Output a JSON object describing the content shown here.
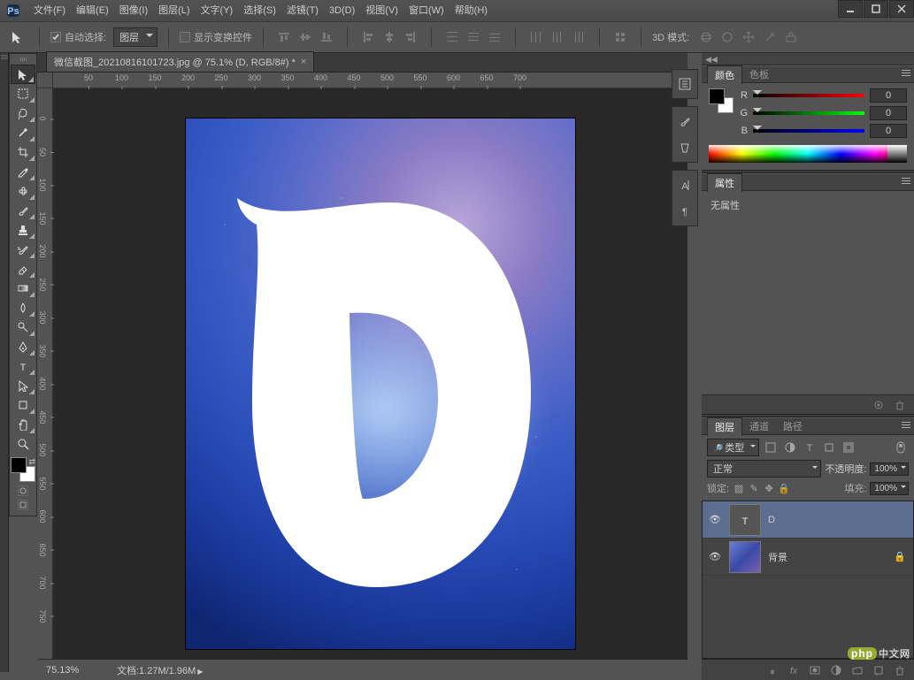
{
  "menubar": {
    "items": [
      "文件(F)",
      "编辑(E)",
      "图像(I)",
      "图层(L)",
      "文字(Y)",
      "选择(S)",
      "滤镜(T)",
      "3D(D)",
      "视图(V)",
      "窗口(W)",
      "帮助(H)"
    ]
  },
  "optionsbar": {
    "auto_select_label": "自动选择:",
    "select_mode": "图层",
    "show_transform_label": "显示变换控件",
    "mode3d_label": "3D 模式:"
  },
  "document": {
    "tab_title": "微信截图_20210816101723.jpg @ 75.1% (D, RGB/8#) *",
    "letter": "D",
    "ruler_h": [
      "50",
      "100",
      "150",
      "200",
      "250",
      "300",
      "350",
      "400",
      "450",
      "500",
      "550",
      "600",
      "650",
      "700"
    ],
    "ruler_v": [
      "0",
      "50",
      "100",
      "150",
      "200",
      "250",
      "300",
      "350",
      "400",
      "450",
      "500",
      "550",
      "600",
      "650",
      "700",
      "750"
    ]
  },
  "statusbar": {
    "zoom": "75.13%",
    "doc_label": "文档:1.27M/1.96M"
  },
  "panels": {
    "color": {
      "tab_active": "颜色",
      "tab_inactive": "色板",
      "r_label": "R",
      "r_val": "0",
      "g_label": "G",
      "g_val": "0",
      "b_label": "B",
      "b_val": "0"
    },
    "properties": {
      "tab_active": "属性",
      "content": "无属性"
    },
    "layers": {
      "tabs": [
        "图层",
        "通道",
        "路径"
      ],
      "filter_type": "类型",
      "blend_mode": "正常",
      "opacity_label": "不透明度:",
      "opacity_value": "100%",
      "lock_label": "锁定:",
      "fill_label": "填充:",
      "fill_value": "100%",
      "items": [
        {
          "name": "D",
          "type": "text",
          "visible": true,
          "locked": false
        },
        {
          "name": "背景",
          "type": "image",
          "visible": true,
          "locked": true
        }
      ]
    }
  },
  "watermark": "中文网"
}
